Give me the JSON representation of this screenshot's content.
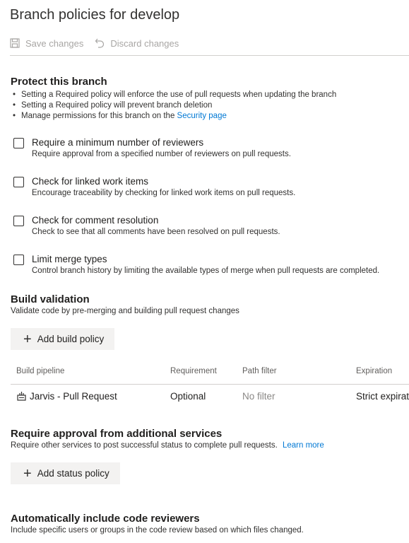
{
  "page": {
    "title": "Branch policies for develop"
  },
  "toolbar": {
    "save_label": "Save changes",
    "discard_label": "Discard changes"
  },
  "protect": {
    "title": "Protect this branch",
    "bullets": [
      "Setting a Required policy will enforce the use of pull requests when updating the branch",
      "Setting a Required policy will prevent branch deletion",
      "Manage permissions for this branch on the"
    ],
    "security_link": "Security page"
  },
  "policies": [
    {
      "title": "Require a minimum number of reviewers",
      "desc": "Require approval from a specified number of reviewers on pull requests.",
      "checked": false
    },
    {
      "title": "Check for linked work items",
      "desc": "Encourage traceability by checking for linked work items on pull requests.",
      "checked": false
    },
    {
      "title": "Check for comment resolution",
      "desc": "Check to see that all comments have been resolved on pull requests.",
      "checked": false
    },
    {
      "title": "Limit merge types",
      "desc": "Control branch history by limiting the available types of merge when pull requests are completed.",
      "checked": false
    }
  ],
  "build_validation": {
    "title": "Build validation",
    "desc": "Validate code by pre-merging and building pull request changes",
    "add_label": "Add build policy",
    "columns": [
      "Build pipeline",
      "Requirement",
      "Path filter",
      "Expiration"
    ],
    "rows": [
      {
        "pipeline": "Jarvis - Pull Request",
        "requirement": "Optional",
        "path_filter": "No filter",
        "expiration": "Strict expirat"
      }
    ]
  },
  "status_checks": {
    "title": "Require approval from additional services",
    "desc": "Require other services to post successful status to complete pull requests.",
    "learn_more": "Learn more",
    "add_label": "Add status policy"
  },
  "reviewers": {
    "title": "Automatically include code reviewers",
    "desc": "Include specific users or groups in the code review based on which files changed."
  }
}
